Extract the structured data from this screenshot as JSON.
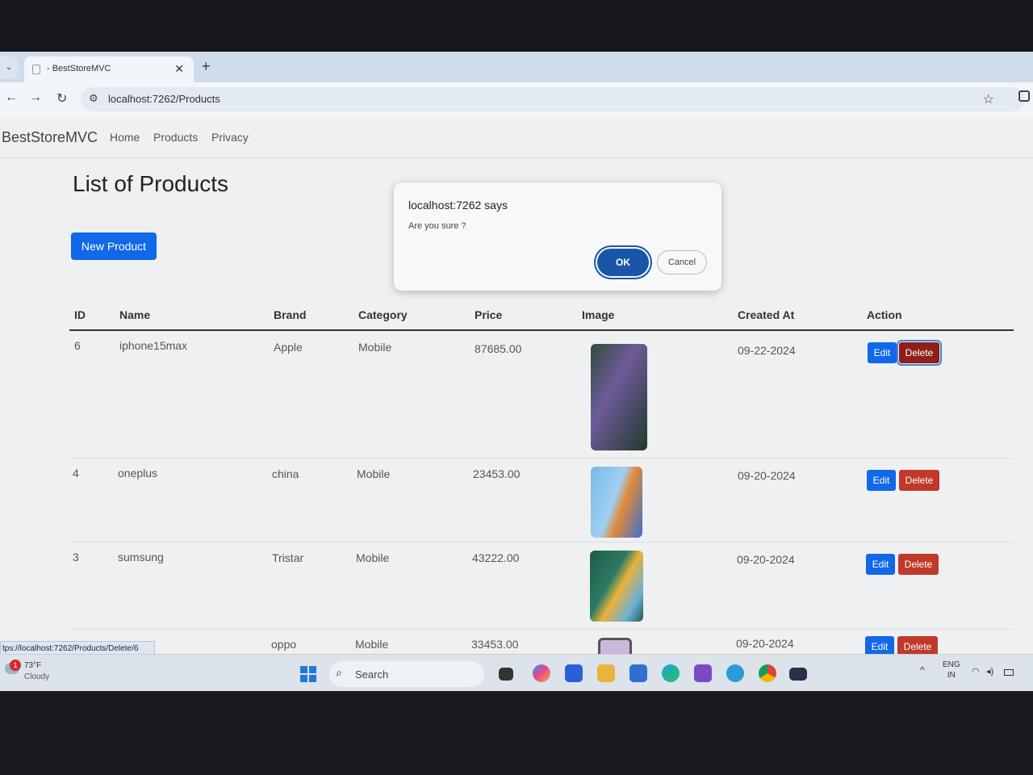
{
  "browser": {
    "tab_title": "- BestStoreMVC",
    "new_tab": "+",
    "url": "localhost:7262/Products",
    "status_url": "tps://localhost:7262/Products/Delete/6"
  },
  "site": {
    "brand": "BestStoreMVC",
    "nav": [
      "Home",
      "Products",
      "Privacy"
    ]
  },
  "page": {
    "title": "List of Products",
    "new_button": "New Product"
  },
  "table": {
    "headers": [
      "ID",
      "Name",
      "Brand",
      "Category",
      "Price",
      "Image",
      "Created At",
      "Action"
    ],
    "rows": [
      {
        "id": "6",
        "name": "iphone15max",
        "brand": "Apple",
        "category": "Mobile",
        "price": "87685.00",
        "created": "09-22-2024",
        "edit": "Edit",
        "delete": "Delete"
      },
      {
        "id": "4",
        "name": "oneplus",
        "brand": "china",
        "category": "Mobile",
        "price": "23453.00",
        "created": "09-20-2024",
        "edit": "Edit",
        "delete": "Delete"
      },
      {
        "id": "3",
        "name": "sumsung",
        "brand": "Tristar",
        "category": "Mobile",
        "price": "43222.00",
        "created": "09-20-2024",
        "edit": "Edit",
        "delete": "Delete"
      },
      {
        "id": "",
        "name": "",
        "brand": "oppo",
        "category": "Mobile",
        "price": "33453.00",
        "created": "09-20-2024",
        "edit": "Edit",
        "delete": "Delete"
      }
    ]
  },
  "dialog": {
    "title": "localhost:7262 says",
    "message": "Are you sure ?",
    "ok": "OK",
    "cancel": "Cancel"
  },
  "taskbar": {
    "weather_badge": "1",
    "weather_temp": "73°F",
    "weather_cond": "Cloudy",
    "search": "Search",
    "lang_top": "ENG",
    "lang_bottom": "IN"
  },
  "colors": {
    "primary": "#1168e8",
    "danger": "#c0392b",
    "dialog_ok": "#1a56a8"
  }
}
